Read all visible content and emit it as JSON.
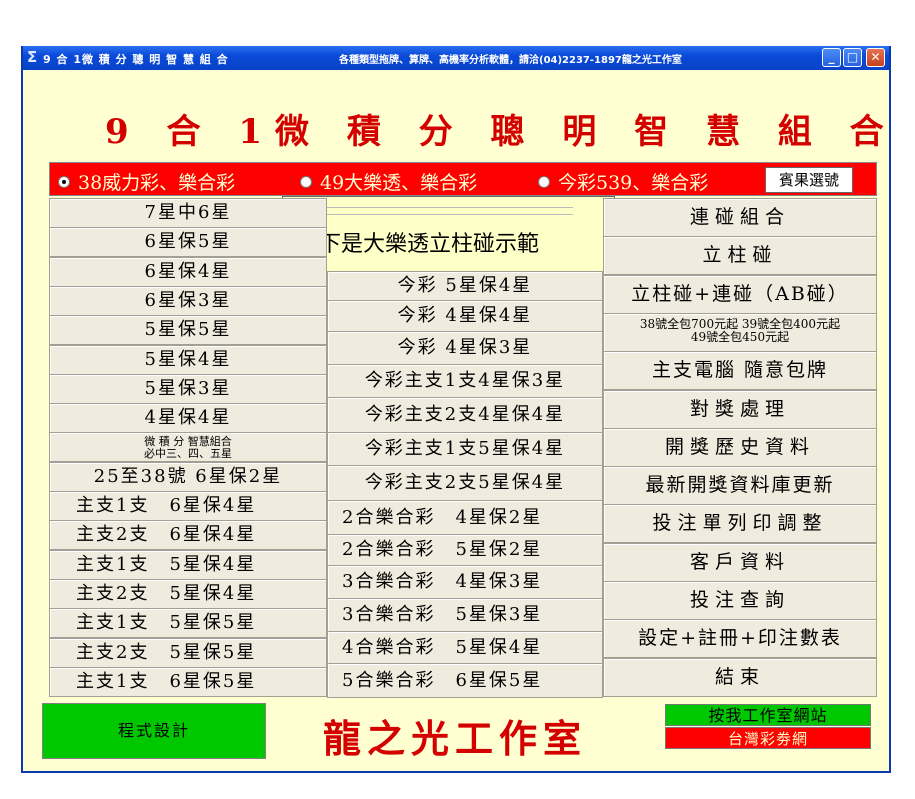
{
  "window": {
    "title": "9 合 1微 積 分 聰 明 智 慧 組 合",
    "subtitle": "各種類型拖牌、算牌、高機率分析軟體，請洽(04)2237-1897龍之光工作室",
    "icon": "sigma-icon"
  },
  "heading": "9 合 1微 積 分 聰 明 智 慧 組 合",
  "radios": [
    {
      "label": "38威力彩、樂合彩",
      "selected": true
    },
    {
      "label": "49大樂透、樂合彩",
      "selected": false
    },
    {
      "label": "今彩539、樂合彩",
      "selected": false
    }
  ],
  "result_button": "賓果選號",
  "col1": [
    "7星中6星",
    "6星保5星",
    "6星保4星",
    "6星保3星",
    "5星保5星",
    "5星保4星",
    "5星保3星",
    "4星保4星",
    {
      "line1": "微 積 分 智慧組合",
      "line2": "必中三、四、五星"
    },
    "25至38號 6星保2星",
    "主支1支　6星保4星",
    "主支2支　6星保4星",
    "主支1支　5星保4星",
    "主支2支　5星保4星",
    "主支1支　5星保5星",
    "主支2支　5星保5星",
    "主支1支　6星保5星"
  ],
  "col2": [
    "今彩 5星保4星",
    "今彩 4星保4星",
    "今彩 4星保3星",
    "今彩主支1支4星保3星",
    "今彩主支2支4星保4星",
    "今彩主支1支5星保4星",
    "今彩主支2支5星保4星",
    "2合樂合彩　4星保2星",
    "2合樂合彩　5星保2星",
    "3合樂合彩　4星保3星",
    "3合樂合彩　5星保3星",
    "4合樂合彩　5星保4星",
    "5合樂合彩　6星保5星"
  ],
  "col3": [
    "連碰組合",
    "立柱碰",
    "立柱碰+連碰（AB碰）",
    {
      "line1": "38號全包700元起 39號全包400元起",
      "line2": "49號全包450元起"
    },
    "主支電腦 隨意包牌",
    "對獎處理",
    "開獎歷史資料",
    "最新開獎資料庫更新",
    "投注單列印調整",
    "客戶資料",
    "投注查詢",
    "設定+註冊+印注數表",
    "結束"
  ],
  "popup": "以下是大樂透立柱碰示範",
  "footer": {
    "design_button": "程式設計",
    "studio_name": "龍之光工作室",
    "website_button": "按我工作室網站",
    "lottery_link": "台灣彩劵網"
  },
  "colors": {
    "title_red": "#d40000",
    "bar_red": "#ff0000",
    "bg": "#ffffd2",
    "green": "#00c800"
  }
}
